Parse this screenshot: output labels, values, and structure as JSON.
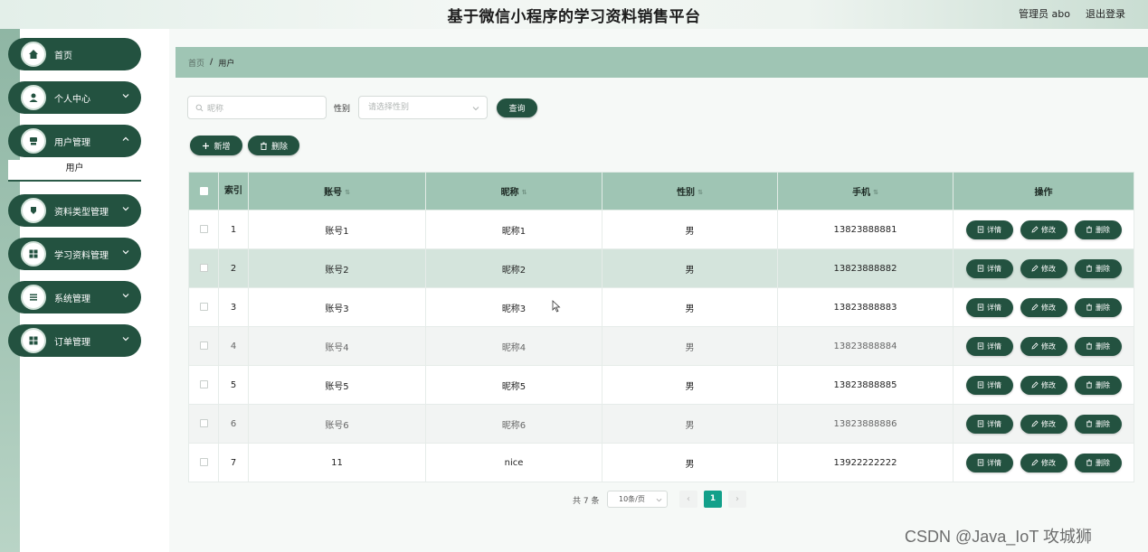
{
  "header": {
    "title": "基于微信小程序的学习资料销售平台",
    "user": "管理员 abo",
    "logout": "退出登录"
  },
  "sidebar": {
    "items": [
      {
        "label": "首页",
        "icon": "home-icon",
        "has_chevron": false
      },
      {
        "label": "个人中心",
        "icon": "person-icon",
        "has_chevron": true
      },
      {
        "label": "用户管理",
        "icon": "user-manage-icon",
        "has_chevron": true
      },
      {
        "label": "资料类型管理",
        "icon": "category-icon",
        "has_chevron": true
      },
      {
        "label": "学习资料管理",
        "icon": "grid-icon",
        "has_chevron": true
      },
      {
        "label": "系统管理",
        "icon": "list-icon",
        "has_chevron": true
      },
      {
        "label": "订单管理",
        "icon": "grid-icon",
        "has_chevron": true
      }
    ],
    "submenu": {
      "label": "用户"
    }
  },
  "breadcrumb": {
    "home": "首页",
    "separator": "/",
    "current": "用户"
  },
  "search": {
    "nickname_placeholder": "昵称",
    "gender_label": "性别",
    "gender_placeholder": "请选择性别",
    "query_button": "查询"
  },
  "actions": {
    "add": "新增",
    "delete": "删除"
  },
  "table": {
    "headers": {
      "index": "索引",
      "account": "账号",
      "nickname": "昵称",
      "gender": "性别",
      "phone": "手机",
      "ops": "操作"
    },
    "rows": [
      {
        "index": "1",
        "account": "账号1",
        "nickname": "昵称1",
        "gender": "男",
        "phone": "13823888881"
      },
      {
        "index": "2",
        "account": "账号2",
        "nickname": "昵称2",
        "gender": "男",
        "phone": "13823888882"
      },
      {
        "index": "3",
        "account": "账号3",
        "nickname": "昵称3",
        "gender": "男",
        "phone": "13823888883"
      },
      {
        "index": "4",
        "account": "账号4",
        "nickname": "昵称4",
        "gender": "男",
        "phone": "13823888884"
      },
      {
        "index": "5",
        "account": "账号5",
        "nickname": "昵称5",
        "gender": "男",
        "phone": "13823888885"
      },
      {
        "index": "6",
        "account": "账号6",
        "nickname": "昵称6",
        "gender": "男",
        "phone": "13823888886"
      },
      {
        "index": "7",
        "account": "11",
        "nickname": "nice",
        "gender": "男",
        "phone": "13922222222"
      }
    ],
    "row_buttons": {
      "detail": "详情",
      "edit": "修改",
      "delete": "删除"
    }
  },
  "pagination": {
    "total": "共 7 条",
    "page_size": "10条/页",
    "prev": "‹",
    "next": "›",
    "current_page": "1"
  },
  "watermark": "CSDN @Java_IoT 攻城狮",
  "colors": {
    "primary": "#235240",
    "header_bg": "#9fc5b4",
    "highlight_row": "#d4e4dc",
    "page_active": "#12a08a"
  }
}
